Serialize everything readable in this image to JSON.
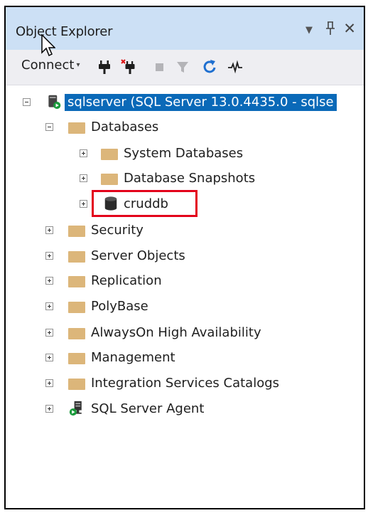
{
  "panel": {
    "title": "Object Explorer",
    "dropdown_icon": "▼",
    "pin_icon": "Ʌ",
    "close_icon": "✕"
  },
  "toolbar": {
    "connect_label": "Connect",
    "connect_caret": "▾",
    "tools": [
      "connect-plug-icon",
      "disconnect-plug-icon",
      "stop-icon",
      "filter-icon",
      "refresh-icon",
      "activity-monitor-icon"
    ]
  },
  "tree": {
    "server": "sqlserver (SQL Server 13.0.4435.0 - sqlse",
    "databases": "Databases",
    "system_databases": "System Databases",
    "database_snapshots": "Database Snapshots",
    "cruddb": "cruddb",
    "security": "Security",
    "server_objects": "Server Objects",
    "replication": "Replication",
    "polybase": "PolyBase",
    "alwayson": "AlwaysOn High Availability",
    "management": "Management",
    "integration_services": "Integration Services Catalogs",
    "sql_agent": "SQL Server Agent"
  },
  "colors": {
    "title_bg": "#cce0f5",
    "selection": "#0a69b8",
    "folder": "#dcb67a",
    "highlight": "#e3001b"
  }
}
